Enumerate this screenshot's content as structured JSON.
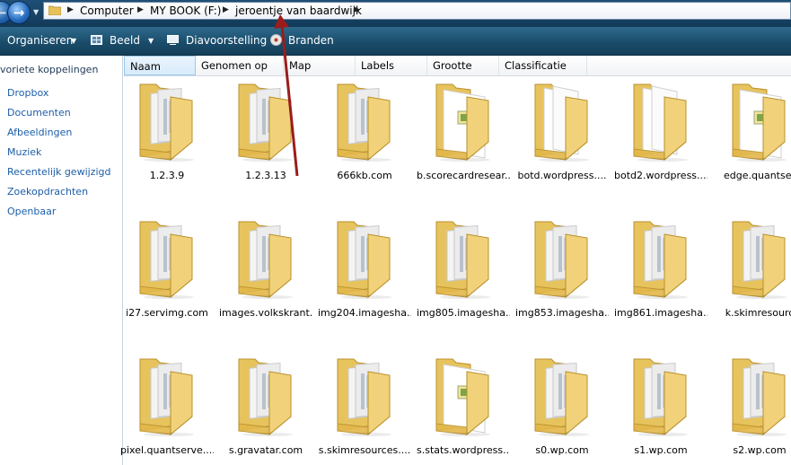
{
  "address": {
    "crumbs": [
      "Computer",
      "MY BOOK (F:)",
      "jeroentje van baardwijk"
    ]
  },
  "toolbar": {
    "organize_label": "Organiseren",
    "view_label": "Beeld",
    "slideshow_label": "Diavoorstelling",
    "burn_label": "Branden"
  },
  "sidebar": {
    "header": "voriete koppelingen",
    "items": [
      {
        "label": "Dropbox"
      },
      {
        "label": "Documenten"
      },
      {
        "label": "Afbeeldingen"
      },
      {
        "label": "Muziek"
      },
      {
        "label": "Recentelijk gewijzigd"
      },
      {
        "label": "Zoekopdrachten"
      },
      {
        "label": "Openbaar"
      }
    ]
  },
  "columns": [
    {
      "label": "Naam"
    },
    {
      "label": "Genomen op"
    },
    {
      "label": "Map"
    },
    {
      "label": "Labels"
    },
    {
      "label": "Grootte"
    },
    {
      "label": "Classificatie"
    }
  ],
  "folders": [
    {
      "label": "1.2.3.9",
      "style": "docs"
    },
    {
      "label": "1.2.3.13",
      "style": "docs"
    },
    {
      "label": "666kb.com",
      "style": "docs"
    },
    {
      "label": "b.scorecardresear...",
      "style": "file"
    },
    {
      "label": "botd.wordpress....",
      "style": "white"
    },
    {
      "label": "botd2.wordpress....",
      "style": "white"
    },
    {
      "label": "edge.quantser",
      "style": "file"
    },
    {
      "label": "i27.servimg.com",
      "style": "docs"
    },
    {
      "label": "images.volkskrant...",
      "style": "docs"
    },
    {
      "label": "img204.imagesha...",
      "style": "docs"
    },
    {
      "label": "img805.imagesha...",
      "style": "docs"
    },
    {
      "label": "img853.imagesha...",
      "style": "docs"
    },
    {
      "label": "img861.imagesha...",
      "style": "docs"
    },
    {
      "label": "k.skimresourc",
      "style": "docs"
    },
    {
      "label": "pixel.quantserve....",
      "style": "docs"
    },
    {
      "label": "s.gravatar.com",
      "style": "docs"
    },
    {
      "label": "s.skimresources....",
      "style": "docs"
    },
    {
      "label": "s.stats.wordpress....",
      "style": "file"
    },
    {
      "label": "s0.wp.com",
      "style": "docs"
    },
    {
      "label": "s1.wp.com",
      "style": "docs"
    },
    {
      "label": "s2.wp.com",
      "style": "docs"
    }
  ],
  "colors": {
    "accent_link": "#1c5ea8",
    "toolbar_bg": "#1a4d6b",
    "annotation_arrow": "#9b1c1c"
  }
}
